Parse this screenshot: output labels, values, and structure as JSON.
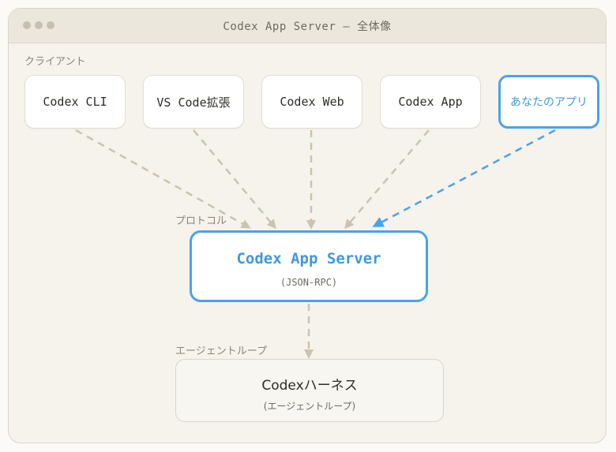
{
  "window": {
    "title": "Codex App Server — 全体像"
  },
  "sections": {
    "clients": "クライアント",
    "protocol": "プロトコル",
    "agent_loop": "エージェントループ"
  },
  "clients": [
    {
      "label": "Codex CLI",
      "highlight": false
    },
    {
      "label": "VS Code拡張",
      "highlight": false
    },
    {
      "label": "Codex Web",
      "highlight": false
    },
    {
      "label": "Codex App",
      "highlight": false
    },
    {
      "label": "あなたのアプリ",
      "highlight": true
    }
  ],
  "server": {
    "title": "Codex App Server",
    "subtitle": "(JSON-RPC)"
  },
  "harness": {
    "title": "Codexハーネス",
    "subtitle": "(エージェントループ)"
  },
  "colors": {
    "accent": "#4aa3ea",
    "arrow": "#cbc3b1",
    "background": "#f6f3ec"
  }
}
